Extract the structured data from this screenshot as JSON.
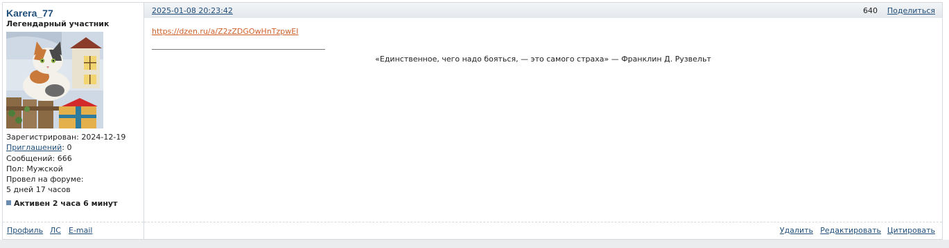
{
  "author": {
    "name": "Karera_77",
    "rank": "Легендарный участник",
    "registered_label": "Зарегистрирован:",
    "registered_value": "2024-12-19",
    "invites_label": "Приглашений",
    "invites_value": ": 0",
    "messages": "Сообщений: 666",
    "gender": "Пол: Мужской",
    "forum_time_label": "Провел на форуме:",
    "forum_time_value": "5 дней 17 часов",
    "active": "Активен 2 часа 6 минут",
    "links": {
      "profile": "Профиль",
      "pm": "ЛС",
      "email": "E-mail"
    }
  },
  "post": {
    "date": "2025-01-08 20:23:42",
    "number": "640",
    "share": "Поделиться",
    "body_link": "https://dzen.ru/a/Z2zZDGOwHnTzpwEI",
    "signature": "«Единственное, чего надо бояться, — это самого страха» — Франклин Д. Рузвельт",
    "actions": {
      "delete": "Удалить",
      "edit": "Редактировать",
      "quote": "Цитировать"
    }
  },
  "icons": {
    "active_status": "square-status-icon",
    "avatar": "cat-on-fence-avatar"
  },
  "colors": {
    "link": "#1f4e7a",
    "body_link": "#d0602a",
    "status_square": "#6a8bb0",
    "header_bg": "#e4e8ec"
  }
}
